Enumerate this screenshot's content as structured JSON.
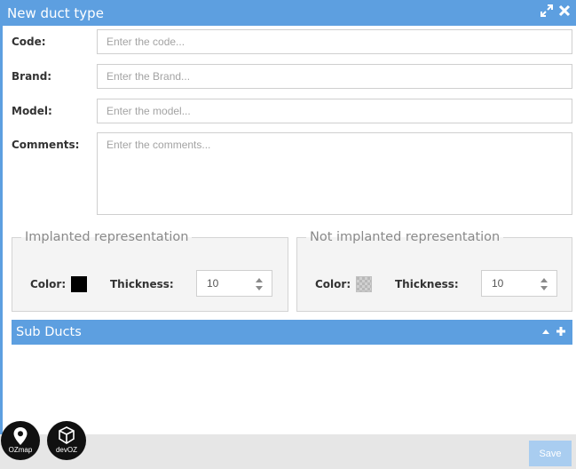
{
  "window": {
    "title": "New duct type"
  },
  "form": {
    "code": {
      "label": "Code:",
      "placeholder": "Enter the code..."
    },
    "brand": {
      "label": "Brand:",
      "placeholder": "Enter the Brand..."
    },
    "model": {
      "label": "Model:",
      "placeholder": "Enter the model..."
    },
    "comments": {
      "label": "Comments:",
      "placeholder": "Enter the comments..."
    }
  },
  "implanted": {
    "legend": "Implanted representation",
    "color_label": "Color:",
    "color": "#000000",
    "thickness_label": "Thickness:",
    "thickness": "10"
  },
  "not_implanted": {
    "legend": "Not implanted representation",
    "color_label": "Color:",
    "color": "#b8b8b8",
    "thickness_label": "Thickness:",
    "thickness": "10"
  },
  "subducts": {
    "title": "Sub Ducts"
  },
  "footer": {
    "save_label": "Save",
    "logo1_text": "OZmap",
    "logo2_text": "devOZ"
  },
  "colors": {
    "accent": "#5d9fe0",
    "save_disabled": "#a9cdf0"
  }
}
